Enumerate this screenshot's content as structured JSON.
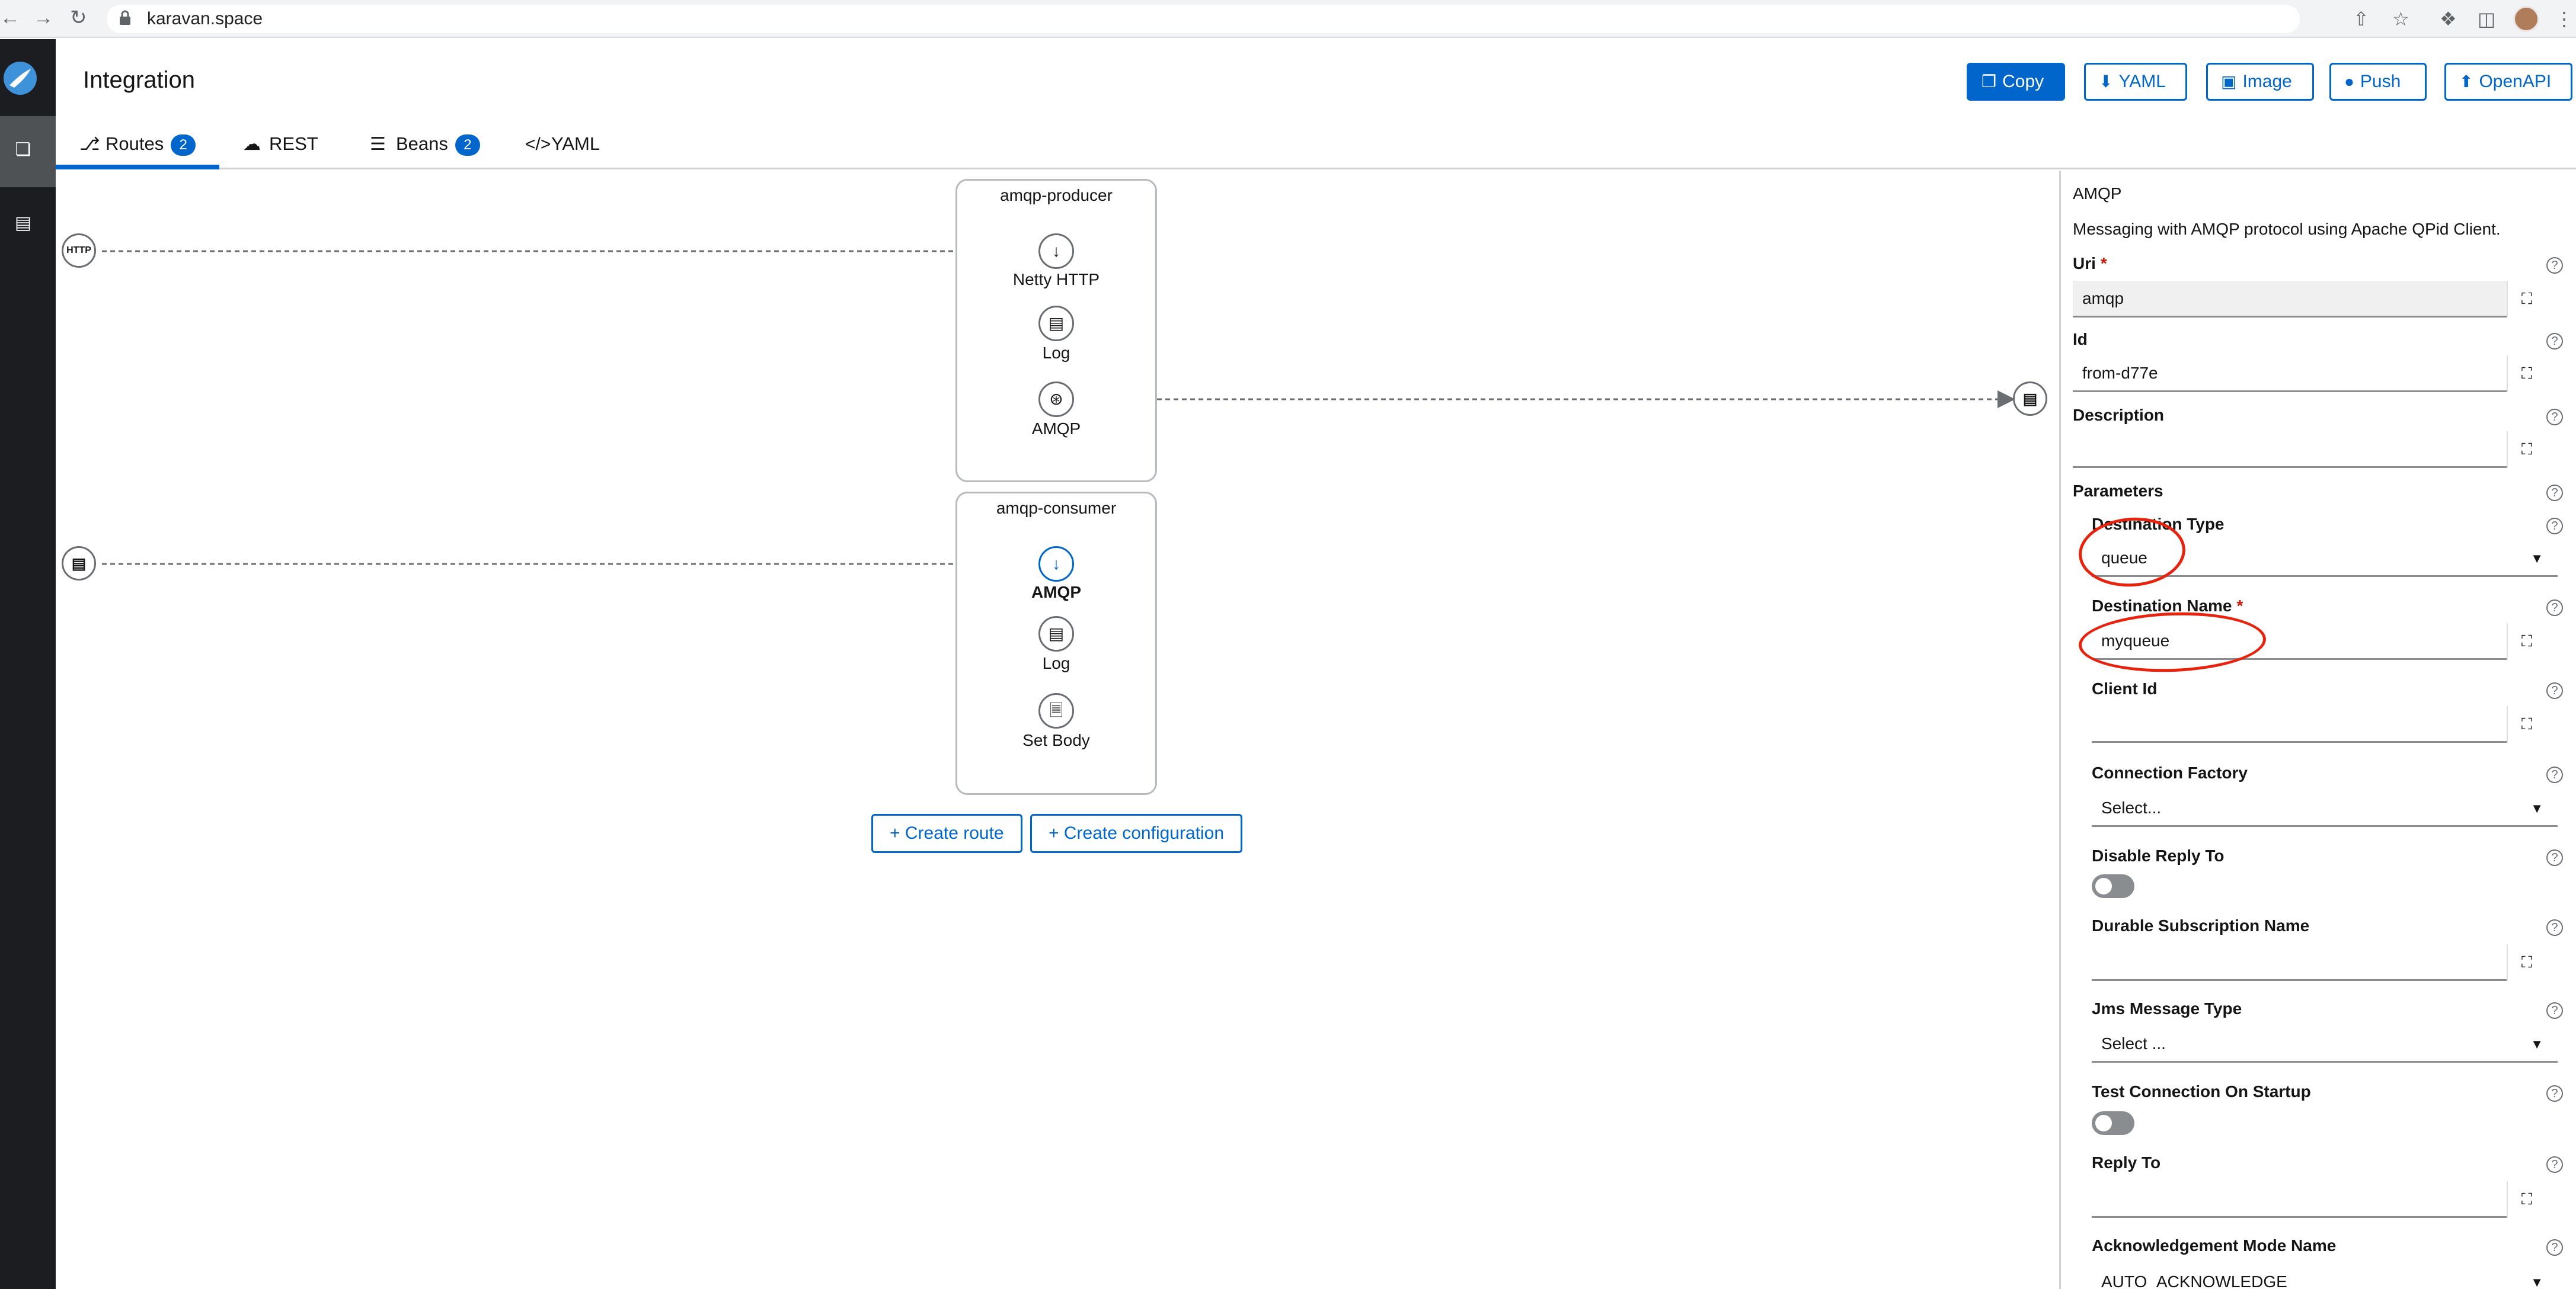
{
  "browser": {
    "url": "karavan.space",
    "back_icon": "arrow-left-icon",
    "forward_icon": "arrow-right-icon",
    "reload_icon": "reload-icon"
  },
  "header": {
    "title": "Integration",
    "buttons": {
      "copy": "Copy",
      "yaml": "YAML",
      "image": "Image",
      "push": "Push",
      "openapi": "OpenAPI"
    }
  },
  "tabs": [
    {
      "label": "Routes",
      "badge": "2"
    },
    {
      "label": "REST",
      "badge": ""
    },
    {
      "label": "Beans",
      "badge": "2"
    },
    {
      "label": "YAML",
      "badge": ""
    }
  ],
  "canvas": {
    "routes": [
      {
        "name": "amqp-producer",
        "steps": [
          {
            "label": "Netty HTTP",
            "icon": "arrow-down-icon"
          },
          {
            "label": "Log",
            "icon": "log-icon"
          },
          {
            "label": "AMQP",
            "icon": "plug-icon"
          }
        ]
      },
      {
        "name": "amqp-consumer",
        "steps": [
          {
            "label": "AMQP",
            "icon": "arrow-down-icon"
          },
          {
            "label": "Log",
            "icon": "log-icon"
          },
          {
            "label": "Set Body",
            "icon": "document-icon"
          }
        ]
      }
    ],
    "external_http_label": "HTTP",
    "create_route": "Create route",
    "create_configuration": "Create configuration"
  },
  "properties": {
    "title": "AMQP",
    "description": "Messaging with AMQP protocol using Apache QPid Client.",
    "uri": {
      "label": "Uri",
      "value": "amqp"
    },
    "id": {
      "label": "Id",
      "value": "from-d77e"
    },
    "description_field": {
      "label": "Description",
      "value": ""
    },
    "parameters_label": "Parameters",
    "destination_type": {
      "label": "Destination Type",
      "value": "queue"
    },
    "destination_name": {
      "label": "Destination Name",
      "value": "myqueue"
    },
    "client_id": {
      "label": "Client Id",
      "value": ""
    },
    "connection_factory": {
      "label": "Connection Factory",
      "value": "Select..."
    },
    "disable_reply_to": {
      "label": "Disable Reply To"
    },
    "durable_subscription_name": {
      "label": "Durable Subscription Name",
      "value": ""
    },
    "jms_message_type": {
      "label": "Jms Message Type",
      "value": "Select ..."
    },
    "test_connection_on_startup": {
      "label": "Test Connection On Startup"
    },
    "reply_to": {
      "label": "Reply To",
      "value": ""
    },
    "acknowledgement_mode_name": {
      "label": "Acknowledgement Mode Name",
      "value": "AUTO_ACKNOWLEDGE"
    }
  },
  "colors": {
    "accent": "#0066cc",
    "annotation": "#e8220c",
    "rail": "#1b1d21"
  }
}
